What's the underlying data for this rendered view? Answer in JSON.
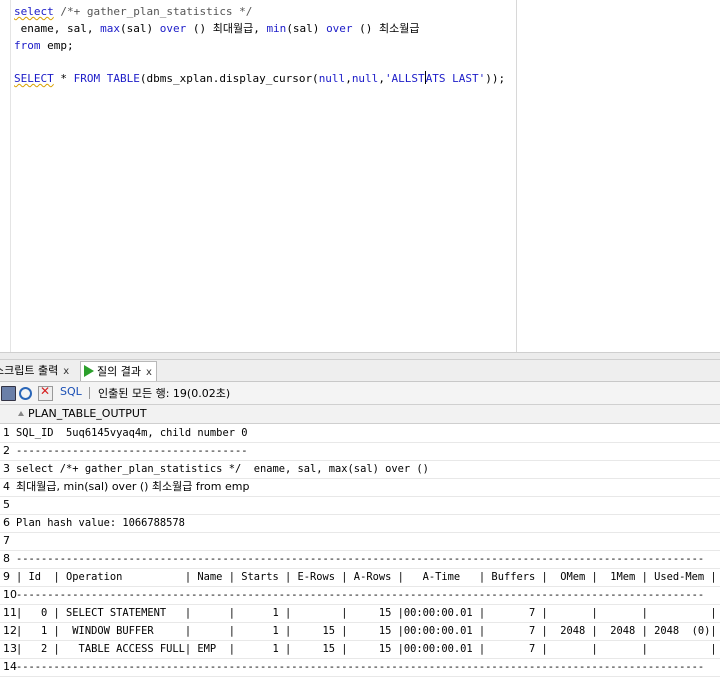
{
  "editor": {
    "lines": [
      {
        "tokens": [
          {
            "t": "select",
            "c": "kw kw-sq"
          },
          {
            "t": " /*+ gather_plan_statistics */",
            "c": "cm"
          }
        ]
      },
      {
        "tokens": [
          {
            "t": " ename, sal, ",
            "c": ""
          },
          {
            "t": "max",
            "c": "fn"
          },
          {
            "t": "(sal) ",
            "c": ""
          },
          {
            "t": "over",
            "c": "kw"
          },
          {
            "t": " () 최대월급, ",
            "c": ""
          },
          {
            "t": "min",
            "c": "fn"
          },
          {
            "t": "(sal) ",
            "c": ""
          },
          {
            "t": "over",
            "c": "kw"
          },
          {
            "t": " () 최소월급",
            "c": ""
          }
        ]
      },
      {
        "tokens": [
          {
            "t": "from",
            "c": "kw"
          },
          {
            "t": " emp;",
            "c": ""
          }
        ]
      },
      {
        "tokens": []
      },
      {
        "tokens": [
          {
            "t": "SELECT",
            "c": "kw kw-sq"
          },
          {
            "t": " * ",
            "c": ""
          },
          {
            "t": "FROM",
            "c": "kw"
          },
          {
            "t": " ",
            "c": ""
          },
          {
            "t": "TABLE",
            "c": "kw"
          },
          {
            "t": "(dbms_xplan.display_cursor(",
            "c": ""
          },
          {
            "t": "null",
            "c": "kw"
          },
          {
            "t": ",",
            "c": ""
          },
          {
            "t": "null",
            "c": "kw"
          },
          {
            "t": ",",
            "c": ""
          },
          {
            "t": "'ALLST",
            "c": "str"
          },
          {
            "t": "|caret|",
            "c": "caret"
          },
          {
            "t": "ATS LAST'",
            "c": "str"
          },
          {
            "t": "));",
            "c": ""
          }
        ]
      }
    ]
  },
  "tabs": [
    {
      "label": "스크립트 출력",
      "close": "x",
      "active": false
    },
    {
      "label": "질의 결과",
      "close": "x",
      "active": true
    }
  ],
  "toolbar": {
    "sql_label": "SQL",
    "status": "인출된 모든 행: 19(0.02초)"
  },
  "grid": {
    "column": "PLAN_TABLE_OUTPUT",
    "rows": [
      {
        "n": "1",
        "text": "SQL_ID  5uq6145vyaq4m, child number 0"
      },
      {
        "n": "2",
        "text": "-------------------------------------"
      },
      {
        "n": "3",
        "text": "select /*+ gather_plan_statistics */  ename, sal, max(sal) over ()"
      },
      {
        "n": "4",
        "text": "최대월급, min(sal) over () 최소월급 from emp"
      },
      {
        "n": "5",
        "text": ""
      },
      {
        "n": "6",
        "text": "Plan hash value: 1066788578"
      },
      {
        "n": "7",
        "text": ""
      },
      {
        "n": "8",
        "text": "--------------------------------------------------------------------------------------------------------------"
      },
      {
        "n": "9",
        "text": "| Id  | Operation          | Name | Starts | E-Rows | A-Rows |   A-Time   | Buffers |  OMem |  1Mem | Used-Mem |"
      },
      {
        "n": "10",
        "text": "--------------------------------------------------------------------------------------------------------------"
      },
      {
        "n": "11",
        "text": "|   0 | SELECT STATEMENT   |      |      1 |        |     15 |00:00:00.01 |       7 |       |       |          |"
      },
      {
        "n": "12",
        "text": "|   1 |  WINDOW BUFFER     |      |      1 |     15 |     15 |00:00:00.01 |       7 |  2048 |  2048 | 2048  (0)|"
      },
      {
        "n": "13",
        "text": "|   2 |   TABLE ACCESS FULL| EMP  |      1 |     15 |     15 |00:00:00.01 |       7 |       |       |          |"
      },
      {
        "n": "14",
        "text": "--------------------------------------------------------------------------------------------------------------"
      }
    ]
  }
}
